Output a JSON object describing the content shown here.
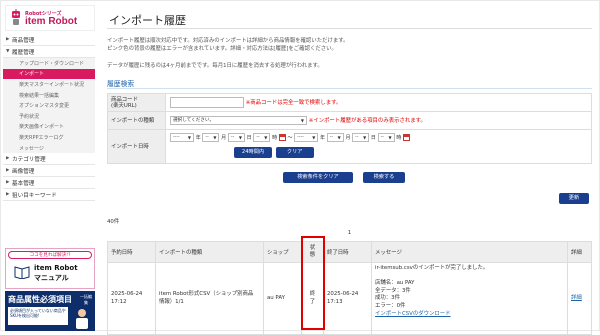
{
  "brand": {
    "small": "Robotシリーズ",
    "name": "item Robot"
  },
  "sidebar": {
    "items": [
      {
        "label": "商品管理",
        "arrow": "▶"
      },
      {
        "label": "履歴管理",
        "arrow": "▼"
      }
    ],
    "subitems": [
      {
        "label": "アップロード・ダウンロード",
        "active": false
      },
      {
        "label": "インポート",
        "active": true
      },
      {
        "label": "楽天マスターインポート状況",
        "active": false
      },
      {
        "label": "検索結果一括編集",
        "active": false
      },
      {
        "label": "オプションマスタ変更",
        "active": false
      },
      {
        "label": "予約状況",
        "active": false
      },
      {
        "label": "楽天画像インポート",
        "active": false
      },
      {
        "label": "楽天RPPエラーログ",
        "active": false
      },
      {
        "label": "メッセージ",
        "active": false
      }
    ],
    "items2": [
      {
        "label": "カテゴリ管理",
        "arrow": "▶"
      },
      {
        "label": "画像管理",
        "arrow": "▶"
      },
      {
        "label": "基本管理",
        "arrow": "▶"
      },
      {
        "label": "狙い目キーワード",
        "arrow": "▶"
      }
    ],
    "banner1": {
      "tag": "ココを見れば解決!?",
      "line1": "item Robot",
      "line2": "マニュアル"
    },
    "banner2": {
      "title": "商品属性必須項目",
      "side": "一括編集",
      "box": "必須項目が入っていない商品やSKUを検出可能!"
    }
  },
  "page": {
    "title": "インポート履歴",
    "desc1": "インポート履歴は順次対応中です。対応済みのインポートは詳細から商品情報を確認いただけます。",
    "desc2": "ピンク色の背景の履歴はエラーが含まれています。詳細・対応方法は[履歴]をご確認ください。",
    "desc3": "データが履歴に残るのは4ヶ月前までです。毎月1日に履歴を消去する処理が行われます。",
    "search_title": "履歴検索"
  },
  "form": {
    "code_label1": "商品コード",
    "code_label2": "(楽天URL)",
    "code_note": "※商品コードは完全一致で検索します。",
    "type_label": "インポートの種類",
    "type_value": "選択してください。",
    "type_note": "※インポート履歴がある項目のみ表示されます。",
    "date_label": "インポート日時",
    "dash": "----",
    "mdash": "--",
    "year": "年",
    "month": "月",
    "day": "日",
    "hour": "時",
    "tilde": "〜",
    "btn_24h": "24時間内",
    "btn_clear": "クリア",
    "btn_clear_cond": "検索条件をクリア",
    "btn_search": "検索する",
    "btn_refresh": "更新"
  },
  "list": {
    "count": "40件",
    "page": "1",
    "headers": [
      "予約日時",
      "インポートの種類",
      "ショップ",
      "状態",
      "終了日時",
      "メッセージ",
      "詳細"
    ],
    "status_header": [
      "状",
      "態"
    ],
    "row": {
      "reserve": [
        "2025-06-24",
        "17:12"
      ],
      "type": [
        "item Robot形式CSV（ショップ別商品",
        "情報）1/1"
      ],
      "shop": "au PAY",
      "status": [
        "終",
        "了"
      ],
      "end": [
        "2025-06-24",
        "17:13"
      ],
      "msg": [
        "ir-itemsub.csvのインポートが完了しました。",
        "",
        "店舗名：au PAY",
        "全データ：3件",
        "成功：3件",
        "エラー：0件"
      ],
      "msg_link": "インポートCSVのダウンロード",
      "detail": "詳細"
    }
  },
  "colors": {
    "brand": "#d81b60",
    "button": "#1b3f8f",
    "link": "#1e63a8",
    "highlight": "#e00000"
  }
}
